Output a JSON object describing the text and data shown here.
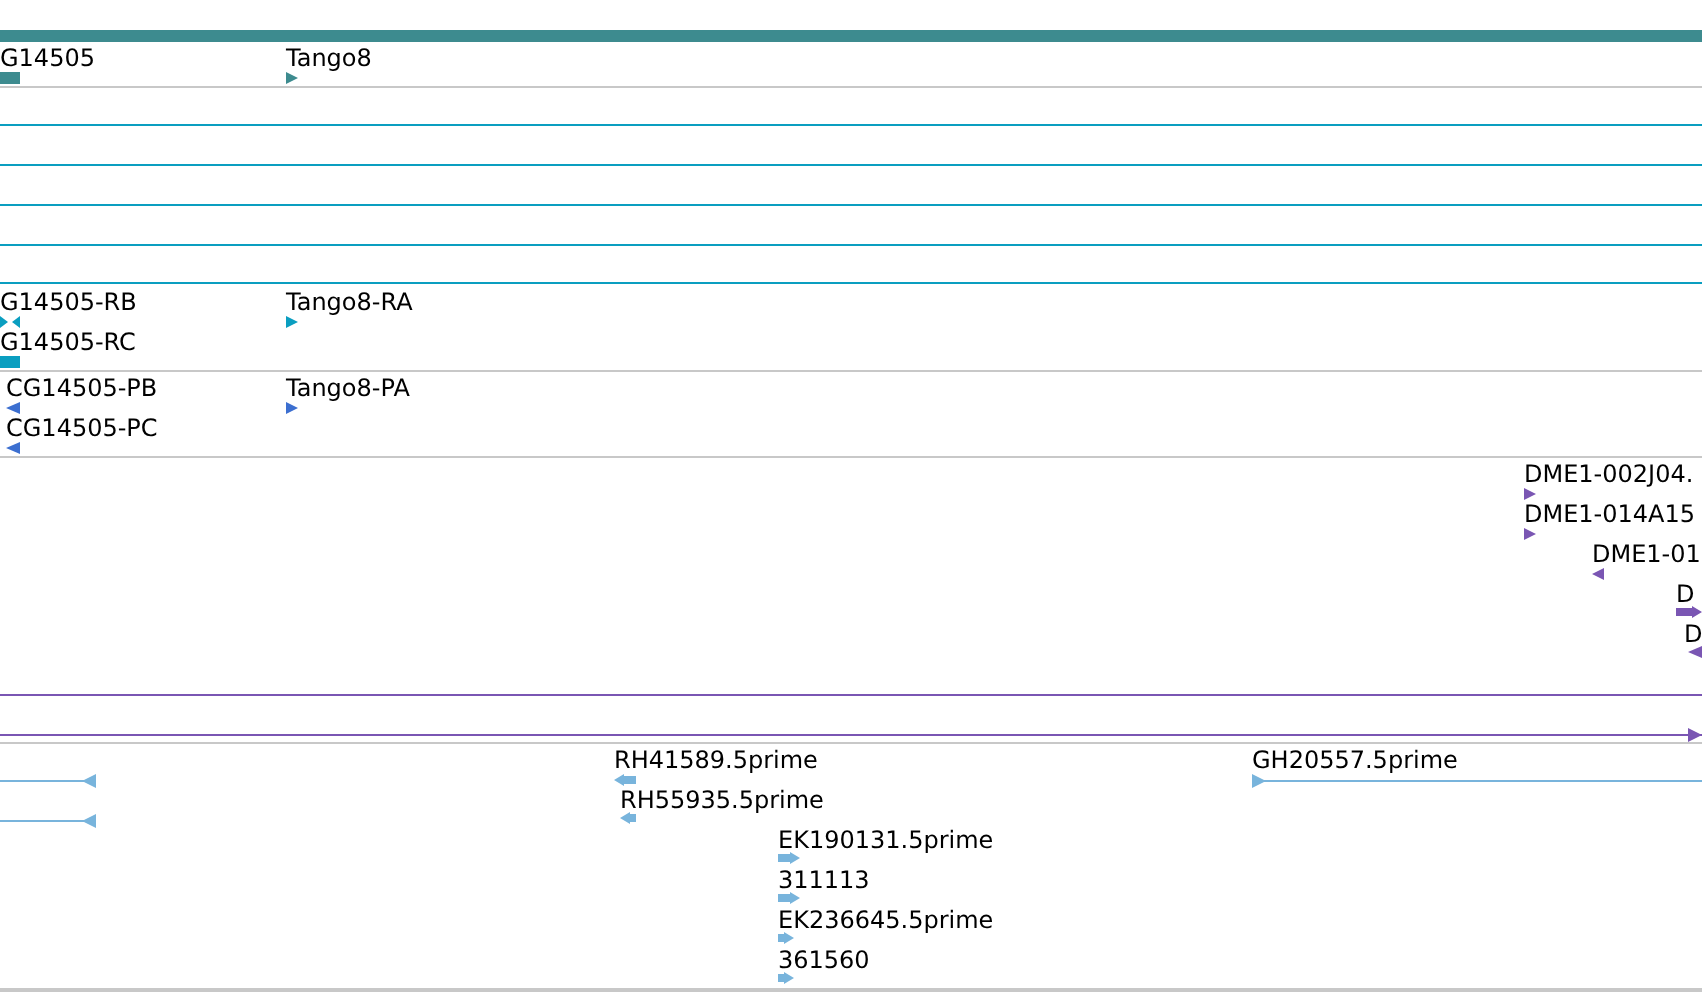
{
  "tracks": [
    {
      "features": [
        {
          "kind": "bar"
        },
        {
          "kind": "block",
          "label": "G14505"
        },
        {
          "kind": "forward",
          "label": "Tango8"
        }
      ]
    },
    {
      "features": [
        {
          "kind": "line"
        },
        {
          "kind": "line"
        },
        {
          "kind": "line"
        },
        {
          "kind": "line"
        }
      ]
    },
    {
      "features": [
        {
          "kind": "both",
          "label": "G14505-RB"
        },
        {
          "kind": "block",
          "label": "G14505-RC"
        },
        {
          "kind": "forward",
          "label": "Tango8-RA"
        }
      ]
    },
    {
      "features": [
        {
          "kind": "reverse",
          "label": "CG14505-PB"
        },
        {
          "kind": "reverse",
          "label": "CG14505-PC"
        },
        {
          "kind": "forward",
          "label": "Tango8-PA"
        }
      ]
    },
    {
      "features": [
        {
          "kind": "forward",
          "label": "DME1-002J04."
        },
        {
          "kind": "forward",
          "label": "DME1-014A15"
        },
        {
          "kind": "reverse",
          "label": "DME1-01"
        },
        {
          "kind": "forward",
          "label": "D"
        },
        {
          "kind": "reverse",
          "label": "D"
        },
        {
          "kind": "line"
        },
        {
          "kind": "line-forward"
        }
      ]
    },
    {
      "features": [
        {
          "kind": "line-reverse"
        },
        {
          "kind": "line-reverse"
        },
        {
          "kind": "reverse",
          "label": "RH41589.5prime"
        },
        {
          "kind": "reverse",
          "label": "RH55935.5prime"
        },
        {
          "kind": "forward",
          "label": "EK190131.5prime"
        },
        {
          "kind": "forward",
          "label": "311113"
        },
        {
          "kind": "forward",
          "label": "EK236645.5prime"
        },
        {
          "kind": "forward",
          "label": "361560"
        },
        {
          "kind": "label",
          "label": "GH20557.5prime"
        },
        {
          "kind": "line-forward"
        }
      ]
    }
  ]
}
